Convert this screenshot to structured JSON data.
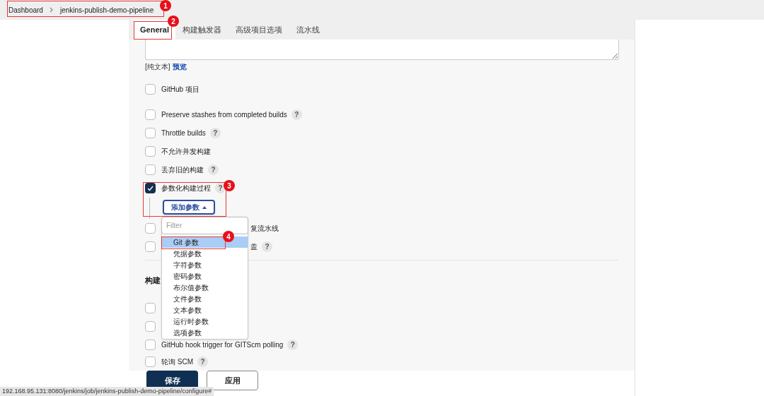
{
  "breadcrumb": [
    {
      "label": "Dashboard"
    },
    {
      "label": "jenkins-publish-demo-pipeline"
    }
  ],
  "tabs": [
    {
      "label": "General",
      "selected": true
    },
    {
      "label": "构建触发器",
      "selected": false
    },
    {
      "label": "高级项目选项",
      "selected": false
    },
    {
      "label": "流水线",
      "selected": false
    }
  ],
  "description": {
    "format_label": "[纯文本]",
    "preview_link": "预览"
  },
  "options": [
    {
      "label": "GitHub 项目",
      "checked": false
    },
    {
      "label": "Preserve stashes from completed builds",
      "checked": false,
      "help": "?"
    },
    {
      "label": "Throttle builds",
      "checked": false,
      "help": "?"
    },
    {
      "label": "不允许并发构建",
      "checked": false
    },
    {
      "label": "丢弃旧的构建",
      "checked": false,
      "help": "?"
    },
    {
      "label": "参数化构建过程",
      "checked": true,
      "help": "?"
    }
  ],
  "add_parameter_button": "添加参数",
  "dropdown": {
    "placeholder": "Filter",
    "items": [
      {
        "label": "Git 参数",
        "selected": true
      },
      {
        "label": "凭据参数",
        "selected": false
      },
      {
        "label": "字符参数",
        "selected": false
      },
      {
        "label": "密码参数",
        "selected": false
      },
      {
        "label": "布尔值参数",
        "selected": false
      },
      {
        "label": "文件参数",
        "selected": false
      },
      {
        "label": "文本参数",
        "selected": false
      },
      {
        "label": "运行时参数",
        "selected": false
      },
      {
        "label": "选项参数",
        "selected": false
      }
    ]
  },
  "more_options": [
    {
      "label": "复流水线",
      "checked": false
    },
    {
      "label": "盖",
      "checked": false,
      "help": "?"
    }
  ],
  "section_heading": "构建",
  "trigger_options": [
    {
      "checked": false
    },
    {
      "checked": false
    },
    {
      "label": "GitHub hook trigger for GITScm polling",
      "checked": false,
      "help": "?"
    },
    {
      "label": "轮询 SCM",
      "checked": false,
      "help": "?"
    }
  ],
  "buttons": [
    {
      "label": "保存",
      "kind": "primary"
    },
    {
      "label": "应用",
      "kind": "secondary"
    }
  ],
  "status_url": "192.168.95.131:8080/jenkins/job/jenkins-publish-demo-pipeline/configure#",
  "annotations": [
    {
      "label": "1"
    },
    {
      "label": "2"
    },
    {
      "label": "3"
    },
    {
      "label": "4"
    }
  ]
}
